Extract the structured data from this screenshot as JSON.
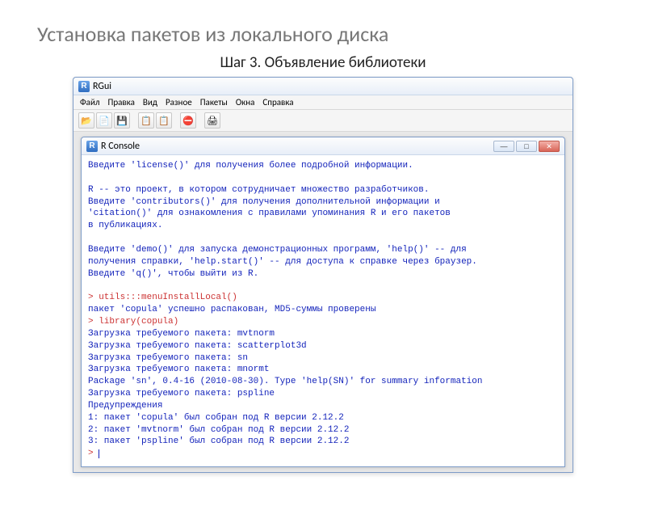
{
  "slide": {
    "title": "Установка пакетов из локального диска",
    "subtitle": "Шаг 3. Объявление библиотеки"
  },
  "app": {
    "title": "RGui",
    "menu": [
      "Файл",
      "Правка",
      "Вид",
      "Разное",
      "Пакеты",
      "Окна",
      "Справка"
    ],
    "toolbar": {
      "open": "📂",
      "load": "📄",
      "save": "💾",
      "copy": "📋",
      "paste": "📋",
      "stop": "⛔",
      "print": "🖨"
    }
  },
  "console": {
    "title": "R Console",
    "l1": "Введите 'license()' для получения более подробной информации.",
    "l2": "",
    "l3": "R -- это проект, в котором сотрудничает множество разработчиков.",
    "l4": "Введите 'contributors()' для получения дополнительной информации и",
    "l5": "'citation()' для ознакомления с правилами упоминания R и его пакетов",
    "l6": "в публикациях.",
    "l7": "",
    "l8": "Введите 'demo()' для запуска демонстрационных программ, 'help()' -- для",
    "l9": "получения справки, 'help.start()' -- для доступа к справке через браузер.",
    "l10": "Введите 'q()', чтобы выйти из R.",
    "l11": "",
    "r1": "> utils:::menuInstallLocal()",
    "l12": "пакет 'copula' успешно распакован, MD5-суммы проверены",
    "r2": "> library(copula)",
    "l13": "Загрузка требуемого пакета: mvtnorm",
    "l14": "Загрузка требуемого пакета: scatterplot3d",
    "l15": "Загрузка требуемого пакета: sn",
    "l16": "Загрузка требуемого пакета: mnormt",
    "l17": "Package 'sn', 0.4-16 (2010-08-30). Type 'help(SN)' for summary information",
    "l18": "Загрузка требуемого пакета: pspline",
    "l19": "Предупреждения",
    "l20": "1: пакет 'copula' был собран под R версии 2.12.2",
    "l21": "2: пакет 'mvtnorm' был собран под R версии 2.12.2",
    "l22": "3: пакет 'pspline' был собран под R версии 2.12.2",
    "r3": "> "
  }
}
